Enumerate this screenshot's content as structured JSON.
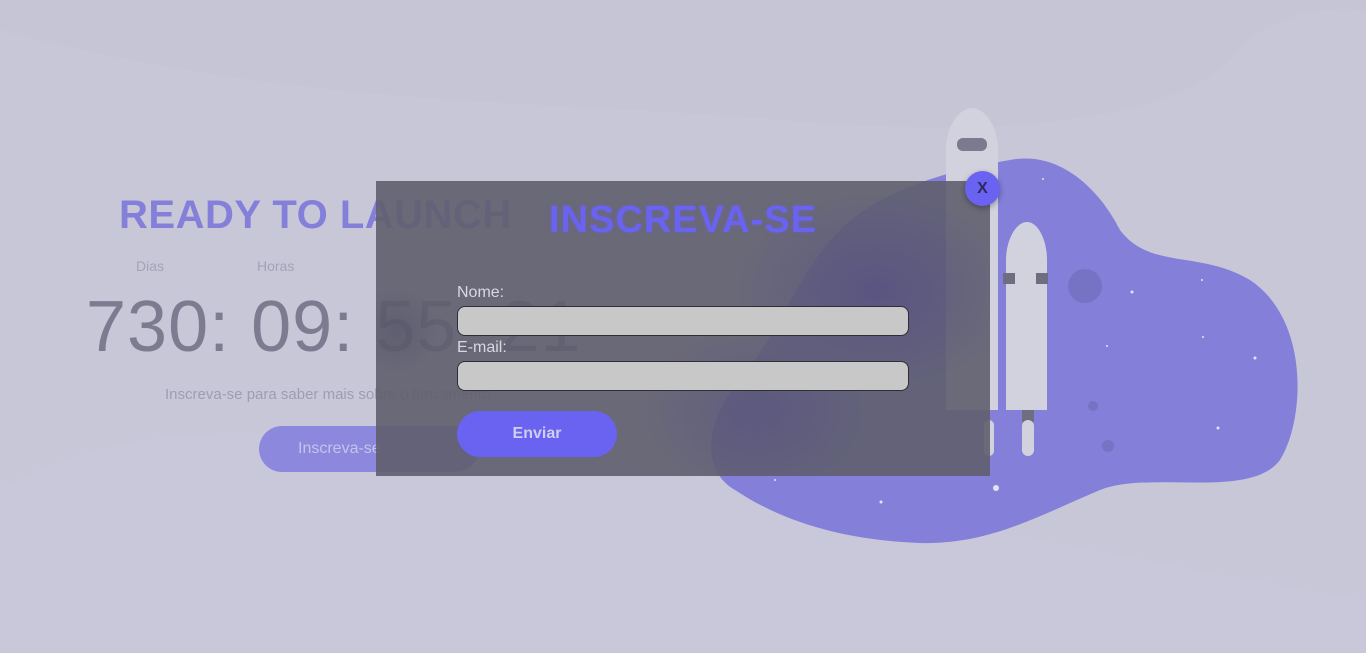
{
  "hero": {
    "title": "READY TO LAUNCH",
    "labels": {
      "days": "Dias",
      "hours": "Horas"
    },
    "countdown": "730: 09: 55: 21",
    "subtitle": "Inscreva-se para saber mais sobre o lançamento",
    "cta_label": "Inscreva-se"
  },
  "modal": {
    "title": "INSCREVA-SE",
    "close_label": "X",
    "name_label": "Nome:",
    "name_value": "",
    "email_label": "E-mail:",
    "email_value": "",
    "submit_label": "Enviar"
  },
  "colors": {
    "page_background": "#c8c7d8",
    "accent": "#6a62f1",
    "blob": "#8480d9",
    "modal_overlay": "#5f5e6e"
  },
  "icons": {
    "rocket": "rocket-illustration",
    "close": "close-icon"
  }
}
